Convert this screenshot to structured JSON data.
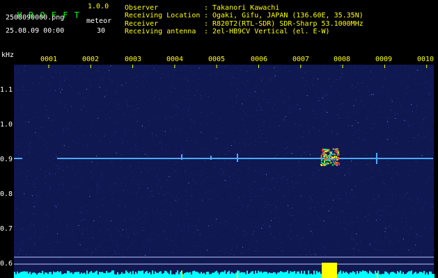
{
  "header": {
    "app_name": "H R O F F T",
    "version": "1.0.0",
    "filename": "2508090000.png",
    "datetime": "25.08.09 00:00",
    "meteor_label": "meteor",
    "meteor_count": "30"
  },
  "info": [
    {
      "label": "Observer",
      "value": "Takanori Kawachi"
    },
    {
      "label": "Receiving Location",
      "value": "Ogaki, Gifu, JAPAN (136.60E, 35.35N)"
    },
    {
      "label": "Receiver",
      "value": "R820T2(RTL-SDR) SDR-Sharp 53.1000MHz"
    },
    {
      "label": "Receiving antenna",
      "value": "2el-HB9CV Vertical (el. E-W)"
    }
  ],
  "axis": {
    "unit": "kHz",
    "y_ticks": [
      "1.1",
      "1.0",
      "0.9",
      "0.8",
      "0.7",
      "0.6"
    ],
    "x_ticks": [
      "0001",
      "0002",
      "0003",
      "0004",
      "0005",
      "0006",
      "0007",
      "0008",
      "0009",
      "0010"
    ]
  },
  "colors": {
    "background": "#000000",
    "spectrogram_bg": "#101a55",
    "carrier": "#4fa9ff",
    "signal_bar": "#00ffff",
    "meteor_bar": "#ffff00",
    "title": "#00ff00",
    "header_text": "#ffff00"
  }
}
